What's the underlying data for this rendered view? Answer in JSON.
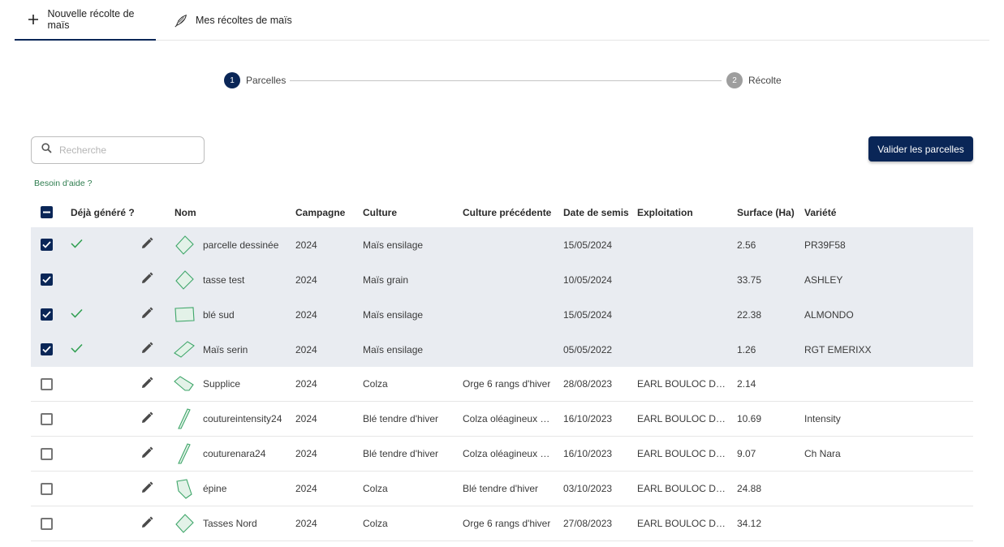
{
  "tabs": [
    {
      "label": "Nouvelle récolte de maïs",
      "icon": "plus-icon",
      "active": true
    },
    {
      "label": "Mes récoltes de maïs",
      "icon": "corn-icon",
      "active": false
    }
  ],
  "stepper": {
    "steps": [
      {
        "number": "1",
        "label": "Parcelles",
        "active": true
      },
      {
        "number": "2",
        "label": "Récolte",
        "active": false
      }
    ]
  },
  "search": {
    "placeholder": "Recherche",
    "value": ""
  },
  "validate_button": "Valider les parcelles",
  "help_link": "Besoin d'aide ?",
  "colors": {
    "primary": "#0a2657",
    "selected_row": "#e9ecf1",
    "success": "#2e9e4f",
    "shape_stroke": "#3fa66a",
    "shape_fill": "#e3f2e8"
  },
  "table": {
    "headers": {
      "generated": "Déjà généré ?",
      "name": "Nom",
      "campaign": "Campagne",
      "culture": "Culture",
      "previous_culture": "Culture précédente",
      "sowing_date": "Date de semis",
      "farm": "Exploitation",
      "surface": "Surface (Ha)",
      "variety": "Variété"
    },
    "rows": [
      {
        "checked": true,
        "generated": true,
        "shape": "diamond",
        "name": "parcelle dessinée",
        "campaign": "2024",
        "culture": "Maïs ensilage",
        "previous_culture": "",
        "sowing_date": "15/05/2024",
        "farm": "",
        "surface": "2.56",
        "variety": "PR39F58"
      },
      {
        "checked": true,
        "generated": false,
        "shape": "diamond",
        "name": "tasse test",
        "campaign": "2024",
        "culture": "Maïs grain",
        "previous_culture": "",
        "sowing_date": "10/05/2024",
        "farm": "",
        "surface": "33.75",
        "variety": "ASHLEY"
      },
      {
        "checked": true,
        "generated": true,
        "shape": "rect",
        "name": "blé sud",
        "campaign": "2024",
        "culture": "Maïs ensilage",
        "previous_culture": "",
        "sowing_date": "15/05/2024",
        "farm": "",
        "surface": "22.38",
        "variety": "ALMONDO"
      },
      {
        "checked": true,
        "generated": true,
        "shape": "flat-diamond",
        "name": "Maïs serin",
        "campaign": "2024",
        "culture": "Maïs ensilage",
        "previous_culture": "",
        "sowing_date": "05/05/2022",
        "farm": "",
        "surface": "1.26",
        "variety": "RGT EMERIXX"
      },
      {
        "checked": false,
        "generated": false,
        "shape": "hexagon",
        "name": "Supplice",
        "campaign": "2024",
        "culture": "Colza",
        "previous_culture": "Orge 6 rangs d'hiver",
        "sowing_date": "28/08/2023",
        "farm": "EARL BOULOC DUV...",
        "surface": "2.14",
        "variety": ""
      },
      {
        "checked": false,
        "generated": false,
        "shape": "strip",
        "name": "coutureintensity24",
        "campaign": "2024",
        "culture": "Blé tendre d'hiver",
        "previous_culture": "Colza oléagineux d'...",
        "sowing_date": "16/10/2023",
        "farm": "EARL BOULOC DUV...",
        "surface": "10.69",
        "variety": "Intensity"
      },
      {
        "checked": false,
        "generated": false,
        "shape": "strip",
        "name": "couturenara24",
        "campaign": "2024",
        "culture": "Blé tendre d'hiver",
        "previous_culture": "Colza oléagineux d'...",
        "sowing_date": "16/10/2023",
        "farm": "EARL BOULOC DUV...",
        "surface": "9.07",
        "variety": "Ch Nara"
      },
      {
        "checked": false,
        "generated": false,
        "shape": "pentagon",
        "name": "épine",
        "campaign": "2024",
        "culture": "Colza",
        "previous_culture": "Blé tendre d'hiver",
        "sowing_date": "03/10/2023",
        "farm": "EARL BOULOC DUV...",
        "surface": "24.88",
        "variety": ""
      },
      {
        "checked": false,
        "generated": false,
        "shape": "diamond",
        "name": "Tasses Nord",
        "campaign": "2024",
        "culture": "Colza",
        "previous_culture": "Orge 6 rangs d'hiver",
        "sowing_date": "27/08/2023",
        "farm": "EARL BOULOC DUV...",
        "surface": "34.12",
        "variety": ""
      }
    ]
  }
}
